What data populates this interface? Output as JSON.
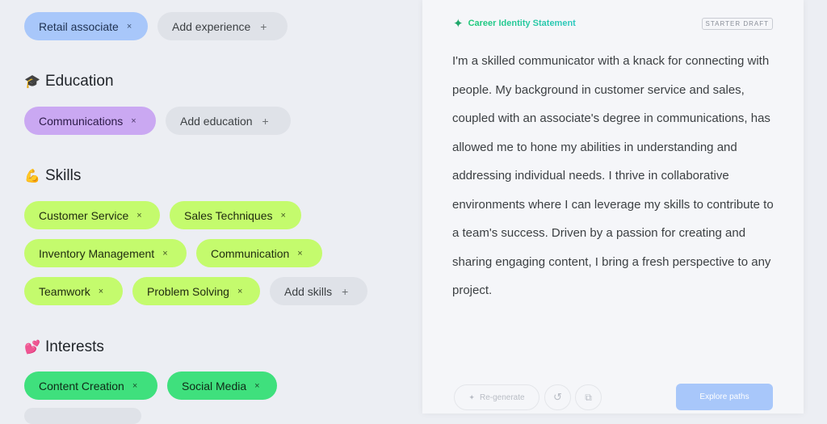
{
  "experience": {
    "chips": [
      "Retail associate"
    ],
    "add_label": "Add experience"
  },
  "education": {
    "emoji": "🎓",
    "title": "Education",
    "chips": [
      "Communications"
    ],
    "add_label": "Add education"
  },
  "skills": {
    "emoji": "💪",
    "title": "Skills",
    "chips": [
      "Customer Service",
      "Sales Techniques",
      "Inventory Management",
      "Communication",
      "Teamwork",
      "Problem Solving"
    ],
    "add_label": "Add skills"
  },
  "interests": {
    "emoji": "💕",
    "title": "Interests",
    "chips": [
      "Content Creation",
      "Social Media"
    ]
  },
  "icons": {
    "remove": "×",
    "add": "+",
    "sparkle": "✦",
    "history": "↺",
    "copy": "⧉"
  },
  "panel": {
    "title": "Career Identity Statement",
    "badge": "STARTER DRAFT",
    "statement": "I'm a skilled communicator with a knack for connecting with people. My background in customer service and sales, coupled with an associate's degree in communications, has allowed me to hone my abilities in understanding and addressing individual needs. I thrive in collaborative environments where I can leverage my skills to contribute to a team's success. Driven by a passion for creating and sharing engaging content, I bring a fresh perspective to any project.",
    "regenerate_label": "Re-generate",
    "explore_label": "Explore paths"
  },
  "colors": {
    "experience_chip": "#a8c7fa",
    "education_chip": "#caa8f2",
    "skill_chip": "#c4fb6d",
    "interest_chip": "#3fe07d",
    "add_chip": "#dfe2e8",
    "primary_button": "#a8c7fa"
  }
}
